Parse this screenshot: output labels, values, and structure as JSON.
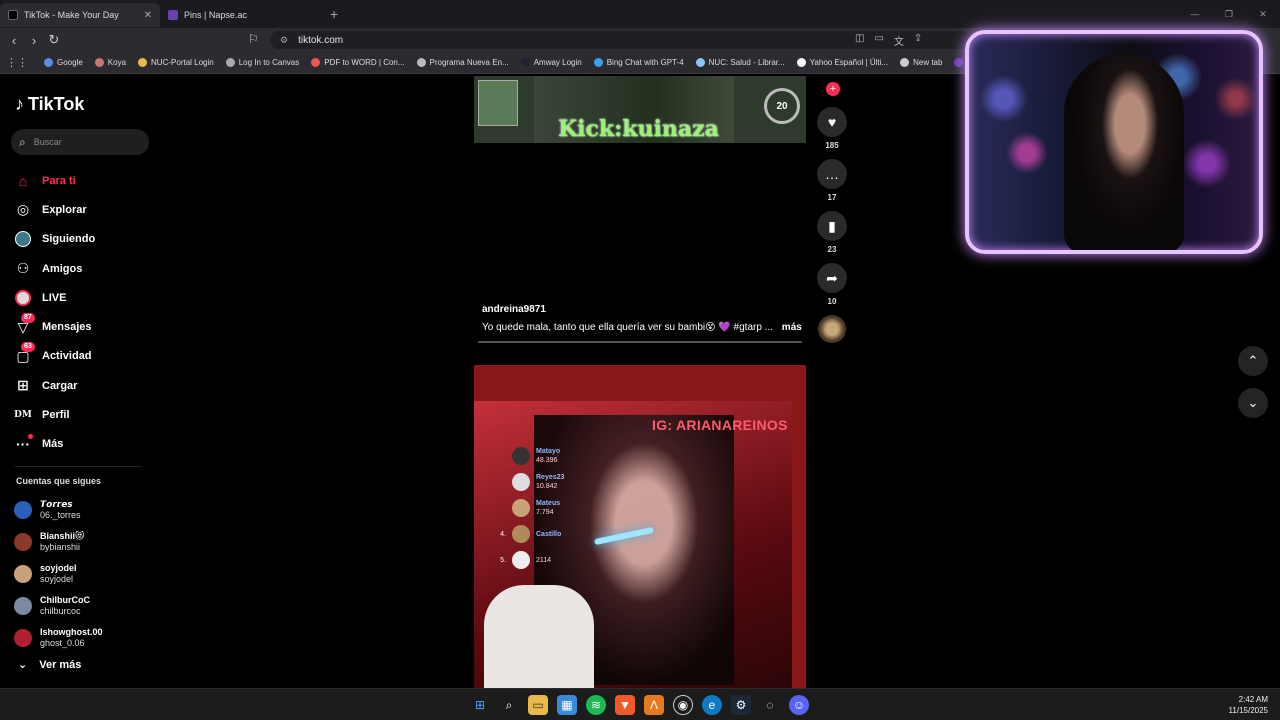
{
  "browser": {
    "tabs": [
      {
        "title": "TikTok - Make Your Day",
        "active": true
      },
      {
        "title": "Pins | Napse.ac",
        "active": false
      }
    ],
    "url": "tiktok.com",
    "bookmarks": [
      "Google",
      "Koya",
      "NUC-Portal Login",
      "Log In to Canvas",
      "PDF to WORD | Con...",
      "Programa Nueva En...",
      "Amway Login",
      "Bing Chat with GPT-4",
      "NUC: Salud - Librar...",
      "Yahoo Español | Últi...",
      "New tab",
      "D"
    ]
  },
  "sidebar": {
    "logo": "TikTok",
    "search_placeholder": "Buscar",
    "menu": [
      {
        "label": "Para ti",
        "icon": "home-icon",
        "active": true
      },
      {
        "label": "Explorar",
        "icon": "compass-icon"
      },
      {
        "label": "Siguiendo",
        "icon": "following-avatar-icon"
      },
      {
        "label": "Amigos",
        "icon": "friends-icon"
      },
      {
        "label": "LIVE",
        "icon": "live-icon"
      },
      {
        "label": "Mensajes",
        "icon": "messages-icon",
        "badge": "87"
      },
      {
        "label": "Actividad",
        "icon": "activity-icon",
        "badge": "63"
      },
      {
        "label": "Cargar",
        "icon": "upload-icon"
      },
      {
        "label": "Perfil",
        "icon": "profile-icon"
      },
      {
        "label": "Más",
        "icon": "more-icon"
      }
    ],
    "following_title": "Cuentas que sigues",
    "following": [
      {
        "name": "𝙏𝙤𝙧𝙧𝙚𝙨",
        "handle": "06._torres",
        "color": "#2a5fb8"
      },
      {
        "name": "Bianshii😻",
        "handle": "bybianshii",
        "color": "#8a3a2a"
      },
      {
        "name": "soyjodel",
        "handle": "soyjodel",
        "color": "#c9a27a"
      },
      {
        "name": "ChilburCoC",
        "handle": "chilburcoc",
        "color": "#7a8aa0"
      },
      {
        "name": "Ishowghost.00",
        "handle": "ghost_0.06",
        "color": "#b02030"
      }
    ],
    "see_more": "Ver más"
  },
  "feed": {
    "video1": {
      "overlay_text": "Kick:kuinaza",
      "hud_number": "20"
    },
    "caption": {
      "user": "andreina9871",
      "text": "Yo quede mala, tanto que ella quería ver su bambi😵 💜 #gtarp ...",
      "more": "más"
    },
    "actions": [
      {
        "icon": "heart-icon",
        "count": "185"
      },
      {
        "icon": "comment-icon",
        "count": "17"
      },
      {
        "icon": "bookmark-icon",
        "count": "23"
      },
      {
        "icon": "share-icon",
        "count": "10"
      }
    ],
    "video2": {
      "overlay_text": "IG: ARIANAREINOS",
      "leaderboard": [
        {
          "rank": "",
          "name": "Matayo",
          "score": "48.396"
        },
        {
          "rank": "",
          "name": "Reyes23",
          "score": "10.842"
        },
        {
          "rank": "",
          "name": "Mateus",
          "score": "7.794"
        },
        {
          "rank": "4.",
          "name": "Castillo",
          "score": ""
        },
        {
          "rank": "5.",
          "name": "",
          "score": "2114"
        }
      ]
    }
  },
  "clock": {
    "time": "2:42 AM",
    "date": "11/15/2025"
  },
  "colors": {
    "accent": "#fe2c55",
    "cam_border": "#e7c4ff",
    "kick_text": "#9df07a"
  }
}
